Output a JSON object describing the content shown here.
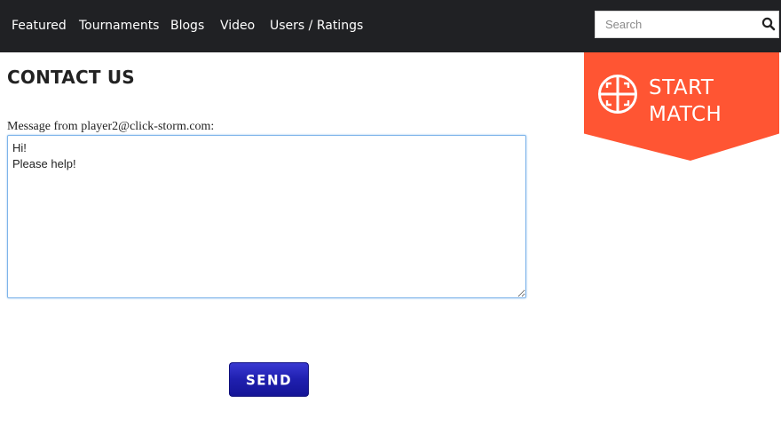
{
  "nav": {
    "items": [
      "Featured",
      "Tournaments",
      "Blogs",
      "Video",
      "Users / Ratings"
    ],
    "search_placeholder": "Search"
  },
  "promo": {
    "line1": "START",
    "line2": "MATCH",
    "icon": "crosshair-icon",
    "color": "#ff5533"
  },
  "page": {
    "title": "CONTACT US",
    "message_label": "Message from player2@click-storm.com:",
    "message_value": "Hi!\nPlease help!",
    "send_label": "SEND"
  },
  "colors": {
    "nav_bg": "#202124",
    "send_button": "#1f1fae"
  }
}
